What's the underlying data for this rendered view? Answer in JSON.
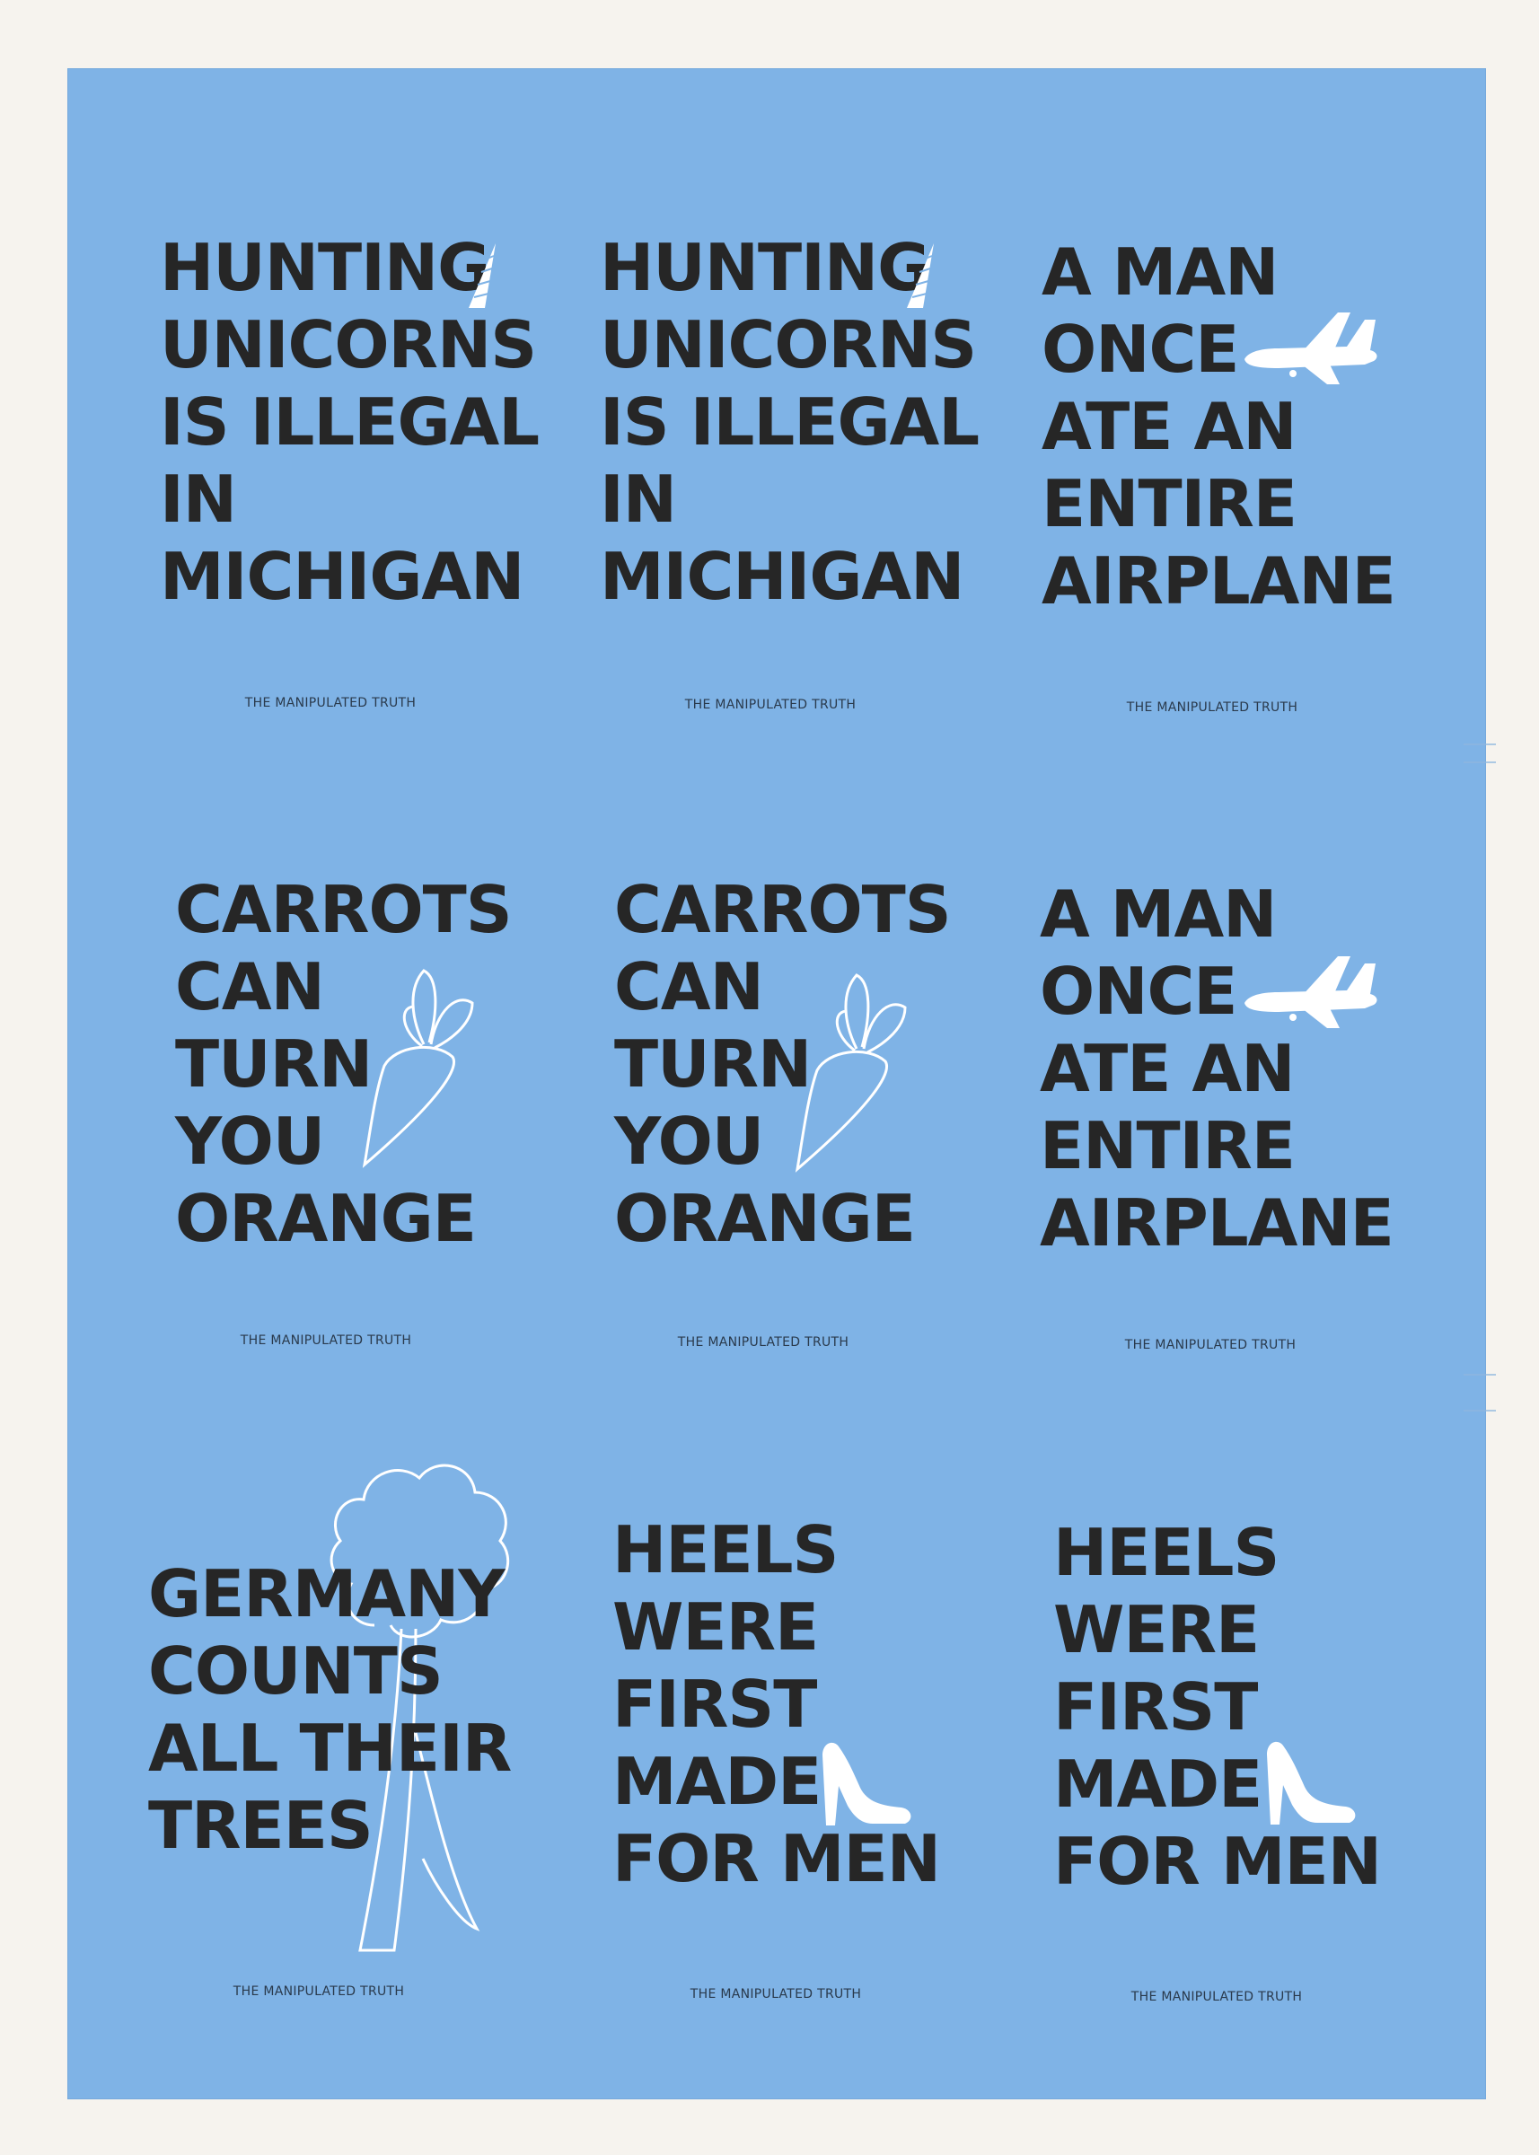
{
  "colors": {
    "sheet": "#7fb3e6",
    "paper": "#f6f3ee",
    "text": "#262626",
    "illustration": "#ffffff"
  },
  "cards": [
    {
      "lines": [
        "HUNTING",
        "UNICORNS",
        "IS ILLEGAL",
        "IN",
        "MICHIGAN"
      ],
      "icon": "unicorn-horn-icon",
      "footer": "THE MANIPULATED TRUTH"
    },
    {
      "lines": [
        "HUNTING",
        "UNICORNS",
        "IS ILLEGAL",
        "IN",
        "MICHIGAN"
      ],
      "icon": "unicorn-horn-icon",
      "footer": "THE MANIPULATED TRUTH"
    },
    {
      "lines": [
        "A MAN",
        "ONCE",
        "ATE AN",
        "ENTIRE",
        "AIRPLANE"
      ],
      "icon": "airplane-icon",
      "footer": "THE MANIPULATED TRUTH"
    },
    {
      "lines": [
        "CARROTS",
        "CAN",
        "TURN",
        "YOU",
        "ORANGE"
      ],
      "icon": "carrot-icon",
      "footer": "THE MANIPULATED TRUTH"
    },
    {
      "lines": [
        "CARROTS",
        "CAN",
        "TURN",
        "YOU",
        "ORANGE"
      ],
      "icon": "carrot-icon",
      "footer": "THE MANIPULATED TRUTH"
    },
    {
      "lines": [
        "A MAN",
        "ONCE",
        "ATE AN",
        "ENTIRE",
        "AIRPLANE"
      ],
      "icon": "airplane-icon",
      "footer": "THE MANIPULATED TRUTH"
    },
    {
      "lines": [
        "GERMANY",
        "COUNTS",
        "ALL THEIR",
        "TREES"
      ],
      "icon": "tree-icon",
      "footer": "THE MANIPULATED TRUTH"
    },
    {
      "lines": [
        "HEELS",
        "WERE",
        "FIRST",
        "MADE",
        "FOR MEN"
      ],
      "icon": "high-heel-icon",
      "footer": "THE MANIPULATED TRUTH"
    },
    {
      "lines": [
        "HEELS",
        "WERE",
        "FIRST",
        "MADE",
        "FOR MEN"
      ],
      "icon": "high-heel-icon",
      "footer": "THE MANIPULATED TRUTH"
    }
  ]
}
